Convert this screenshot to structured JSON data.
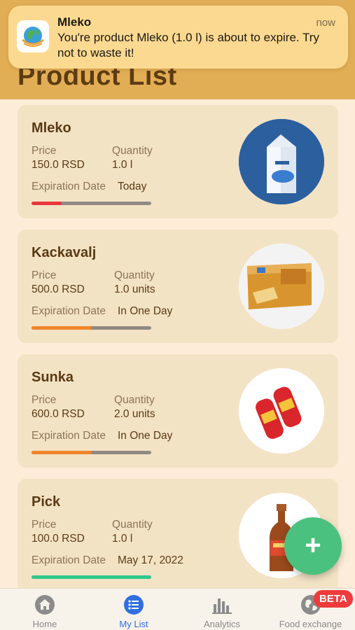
{
  "notification": {
    "app": "Mleko",
    "time": "now",
    "message": "You're product Mleko (1.0 l) is about to expire. Try not to waste it!"
  },
  "page": {
    "title": "Product List"
  },
  "labels": {
    "price": "Price",
    "quantity": "Quantity",
    "expiration": "Expiration Date"
  },
  "products": [
    {
      "name": "Mleko",
      "price": "150.0 RSD",
      "quantity": "1.0 l",
      "expiration": "Today",
      "freshness": 0.25,
      "bar_color": "#e8373c"
    },
    {
      "name": "Kackavalj",
      "price": "500.0 RSD",
      "quantity": "1.0 units",
      "expiration": "In One Day",
      "freshness": 0.5,
      "bar_color": "#f0842a"
    },
    {
      "name": "Sunka",
      "price": "600.0 RSD",
      "quantity": "2.0 units",
      "expiration": "In One Day",
      "freshness": 0.5,
      "bar_color": "#f0842a"
    },
    {
      "name": "Pick",
      "price": "100.0 RSD",
      "quantity": "1.0 l",
      "expiration": "May 17, 2022",
      "freshness": 1.0,
      "bar_color": "#2fc98a"
    }
  ],
  "fab": {
    "symbol": "+"
  },
  "tabs": [
    {
      "label": "Home",
      "icon": "home-icon",
      "active": false
    },
    {
      "label": "My List",
      "icon": "list-icon",
      "active": true
    },
    {
      "label": "Analytics",
      "icon": "bar-chart-icon",
      "active": false
    },
    {
      "label": "Food exchange",
      "icon": "globe-icon",
      "active": false
    }
  ],
  "badge": {
    "text": "BETA"
  },
  "colors": {
    "header": "#e2ae55",
    "accent": "#2f6fe0",
    "fab": "#4ac17e",
    "badge": "#ef3b3b"
  }
}
